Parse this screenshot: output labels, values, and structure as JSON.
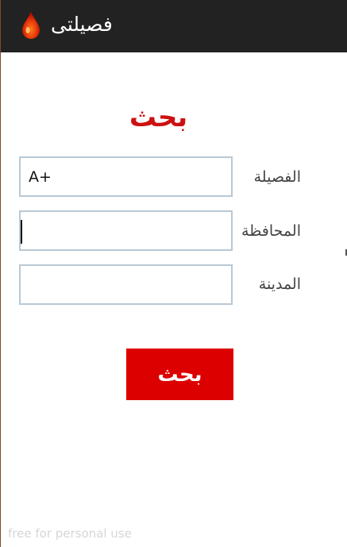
{
  "app_bar": {
    "title": "فصيلتى",
    "icon": "blood-drop-icon"
  },
  "search_form": {
    "heading": "بحث",
    "fields": [
      {
        "label": "الفصيلة",
        "value": "A+",
        "placeholder": ""
      },
      {
        "label": "المحافظة",
        "value": "",
        "placeholder": ""
      },
      {
        "label": "المدينة",
        "value": "",
        "placeholder": ""
      }
    ],
    "submit_label": "بحث"
  },
  "watermark": "free for personal use",
  "colors": {
    "app_bar_bg": "#222222",
    "accent_red": "#dd0000",
    "heading_red": "#cc1111",
    "field_border": "#b8c8d4"
  }
}
